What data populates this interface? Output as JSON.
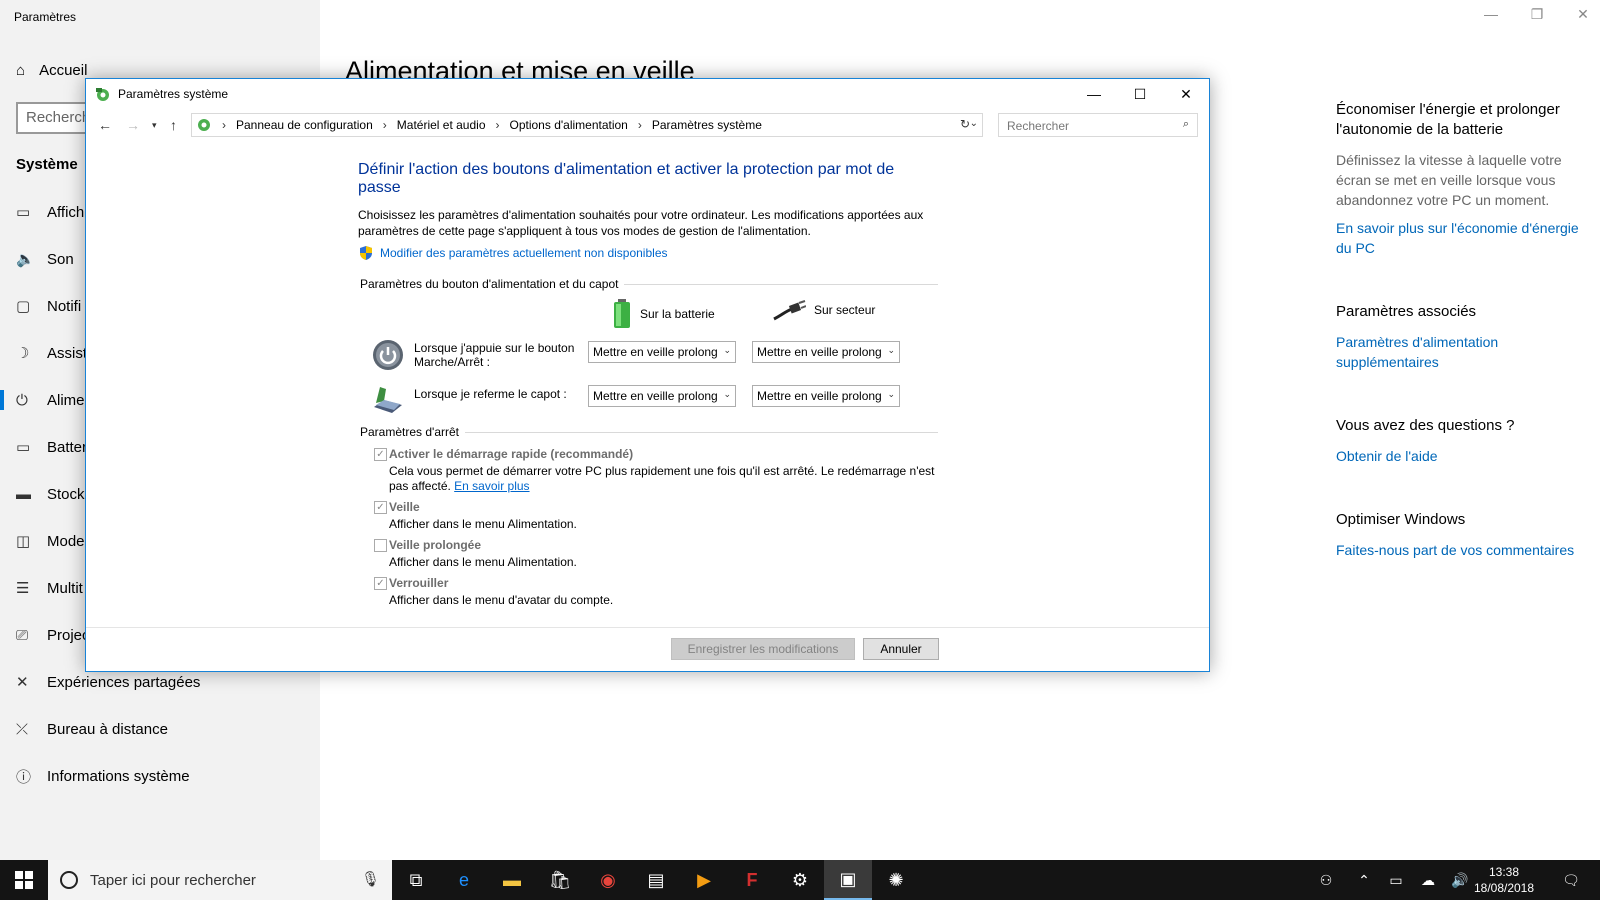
{
  "app": {
    "title": "Paramètres",
    "home": "Accueil",
    "search_placeholder": "Recherch",
    "section": "Système",
    "nav": [
      {
        "label": "Affich",
        "icon": "monitor-icon"
      },
      {
        "label": "Son",
        "icon": "speaker-icon"
      },
      {
        "label": "Notifi",
        "icon": "notification-icon"
      },
      {
        "label": "Assist",
        "icon": "moon-icon"
      },
      {
        "label": "Alime",
        "icon": "power-icon"
      },
      {
        "label": "Batter",
        "icon": "battery-icon"
      },
      {
        "label": "Stocka",
        "icon": "storage-icon"
      },
      {
        "label": "Mode",
        "icon": "tablet-icon"
      },
      {
        "label": "Multit",
        "icon": "multitask-icon"
      },
      {
        "label": "Projec",
        "icon": "project-icon"
      },
      {
        "label": "Expériences partagées",
        "icon": "shared-icon"
      },
      {
        "label": "Bureau à distance",
        "icon": "remote-icon"
      },
      {
        "label": "Informations système",
        "icon": "info-icon"
      }
    ],
    "main_title": "Alimentation et mise en veille"
  },
  "right_panel": {
    "save_heading": "Économiser l'énergie et prolonger l'autonomie de la batterie",
    "save_text": "Définissez la vitesse à laquelle votre écran se met en veille lorsque vous abandonnez votre PC un moment.",
    "save_link": "En savoir plus sur l'économie d'énergie du PC",
    "related_heading": "Paramètres associés",
    "related_link": "Paramètres d'alimentation supplémentaires",
    "questions_heading": "Vous avez des questions ?",
    "questions_link": "Obtenir de l'aide",
    "optimize_heading": "Optimiser Windows",
    "optimize_link": "Faites-nous part de vos commentaires"
  },
  "dialog": {
    "title": "Paramètres système",
    "breadcrumb": [
      "Panneau de configuration",
      "Matériel et audio",
      "Options d'alimentation",
      "Paramètres système"
    ],
    "search_placeholder": "Rechercher",
    "heading": "Définir l'action des boutons d'alimentation et activer la protection par mot de passe",
    "description": "Choisissez les paramètres d'alimentation souhaités pour votre ordinateur. Les modifications apportées aux paramètres de cette page s'appliquent à tous vos modes de gestion de l'alimentation.",
    "admin_link": "Modifier des paramètres actuellement non disponibles",
    "power_section": "Paramètres du bouton d'alimentation et du capot",
    "col_battery": "Sur la batterie",
    "col_plugged": "Sur secteur",
    "power_button_label": "Lorsque j'appuie sur le bouton Marche/Arrêt :",
    "power_button_battery": "Mettre en veille prolong",
    "power_button_plugged": "Mettre en veille prolong",
    "lid_label": "Lorsque je referme le capot :",
    "lid_battery": "Mettre en veille prolong",
    "lid_plugged": "Mettre en veille prolong",
    "shutdown_section": "Paramètres d'arrêt",
    "fast_startup": {
      "label": "Activer le démarrage rapide (recommandé)",
      "desc": "Cela vous permet de démarrer votre PC plus rapidement une fois qu'il est arrêté. Le redémarrage n'est pas affecté.",
      "link": "En savoir plus",
      "checked": true
    },
    "sleep": {
      "label": "Veille",
      "desc": "Afficher dans le menu Alimentation.",
      "checked": true
    },
    "hibernate": {
      "label": "Veille prolongée",
      "desc": "Afficher dans le menu Alimentation.",
      "checked": false
    },
    "lock": {
      "label": "Verrouiller",
      "desc": "Afficher dans le menu d'avatar du compte.",
      "checked": true
    },
    "save_button": "Enregistrer les modifications",
    "cancel_button": "Annuler"
  },
  "taskbar": {
    "search_placeholder": "Taper ici pour rechercher",
    "time": "13:38",
    "date": "18/08/2018"
  }
}
